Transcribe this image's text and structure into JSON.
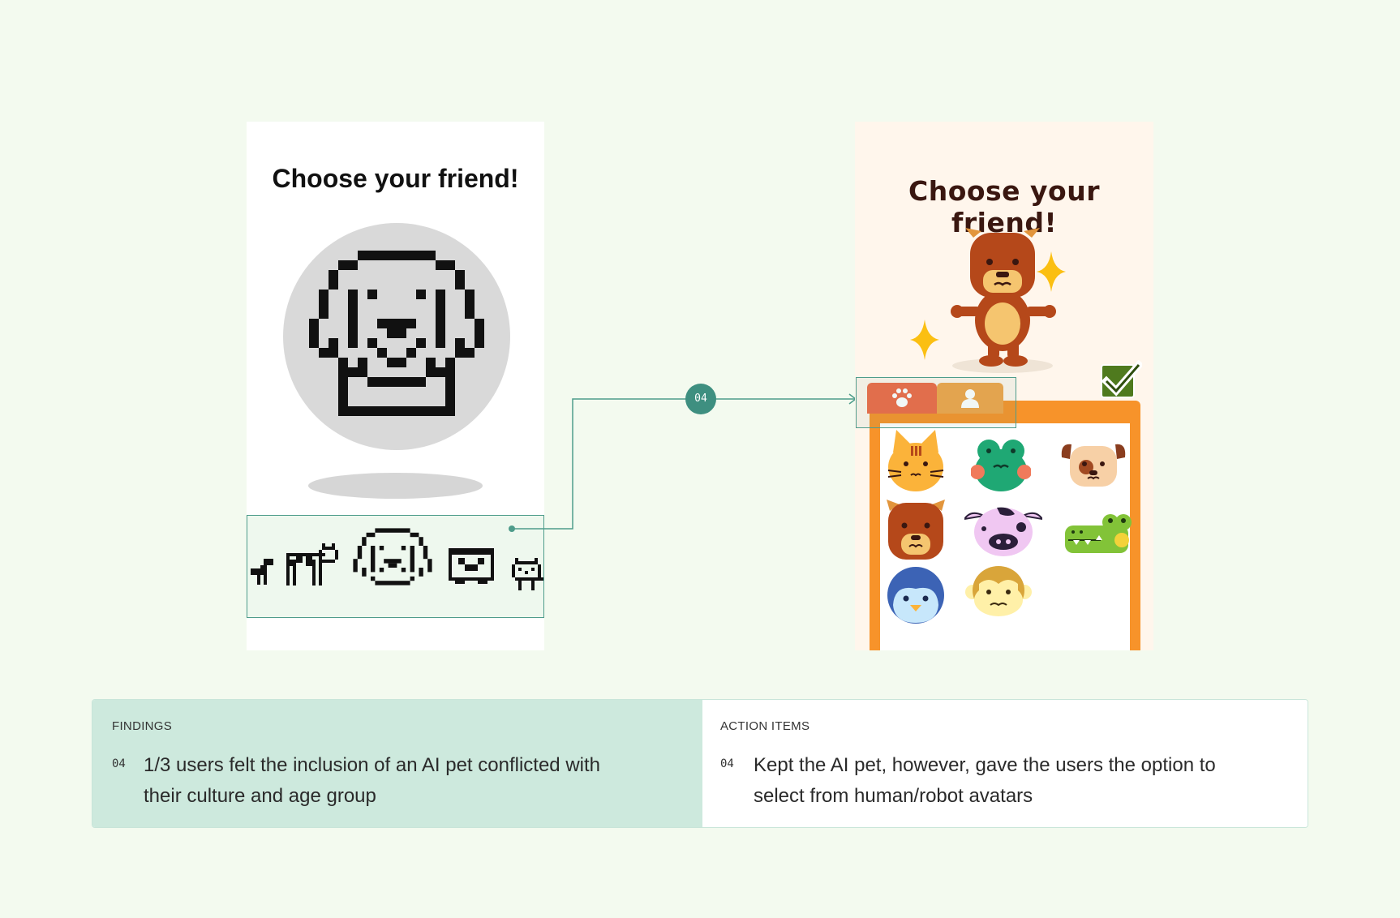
{
  "left_mockup": {
    "title": "Choose your friend!",
    "selected_pet": "pixel-dog",
    "carousel_pets": [
      "pixel-dino",
      "pixel-cow",
      "pixel-dog",
      "pixel-pug",
      "pixel-cat"
    ]
  },
  "connector": {
    "badge": "04",
    "color": "#4e9c8b"
  },
  "right_mockup": {
    "title": "Choose your friend!",
    "selected_pet": "bear",
    "tabs": [
      {
        "icon": "paw-icon",
        "color": "#ee6b47"
      },
      {
        "icon": "person-icon",
        "color": "#f0a54a"
      }
    ],
    "confirm_icon": "checkbox-checked-icon",
    "grid": [
      "cat",
      "frog",
      "pug",
      "bear",
      "cow",
      "crocodile",
      "penguin",
      "monkey"
    ]
  },
  "findings": {
    "label": "FINDINGS",
    "number": "04",
    "text_line1": "1/3 users felt the inclusion of an AI pet conflicted with",
    "text_line2": "their culture and age group"
  },
  "action_items": {
    "label": "ACTION ITEMS",
    "number": "04",
    "text_line1": "Kept the AI pet, however, gave the users the option to",
    "text_line2": "select from human/robot avatars"
  },
  "colors": {
    "background": "#f3faef",
    "accent": "#4e9c8b",
    "findings_bg": "#cde9dd",
    "orange": "#f7932a"
  }
}
